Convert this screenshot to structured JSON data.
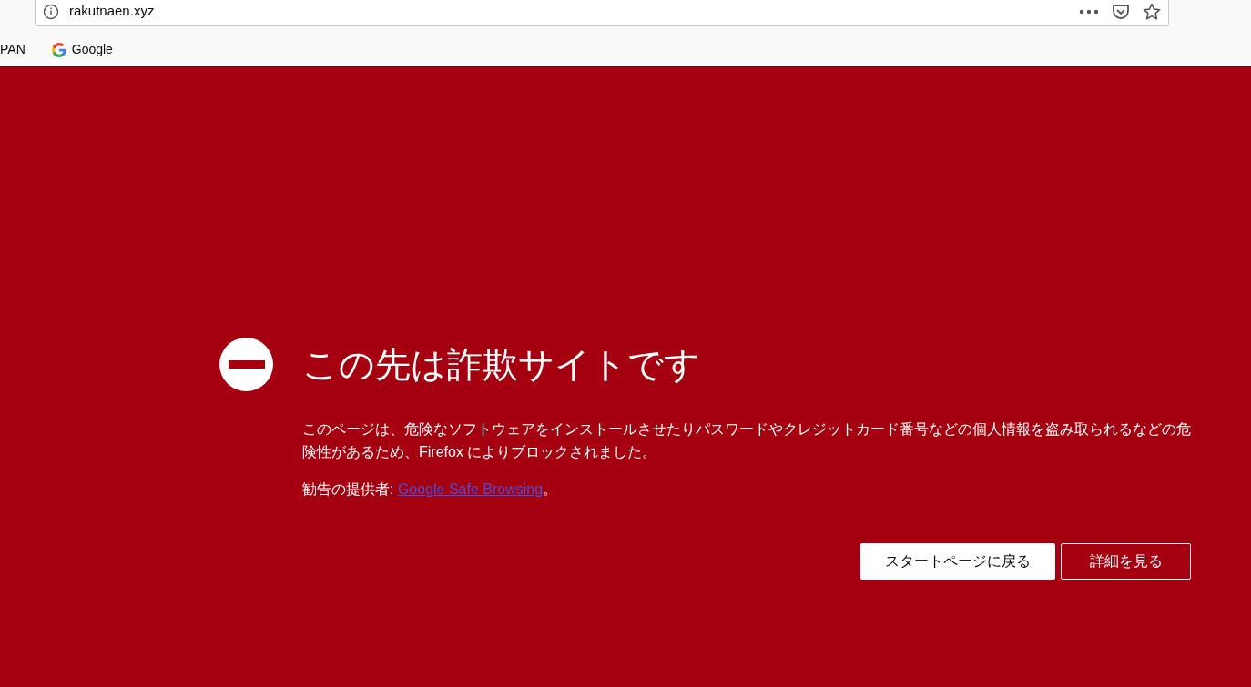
{
  "address_bar": {
    "url": "rakutnaen.xyz"
  },
  "bookmarks": [
    {
      "label": "PAN",
      "kind": "text"
    },
    {
      "label": "Google",
      "kind": "google"
    }
  ],
  "warning": {
    "title": "この先は詐欺サイトです",
    "description": "このページは、危険なソフトウェアをインストールさせたりパスワードやクレジットカード番号などの個人情報を盗み取られるなどの危険性があるため、Firefox によりブロックされました。",
    "advisory_label": "勧告の提供者: ",
    "advisory_link": "Google Safe Browsing",
    "advisory_end": "。",
    "buttons": [
      {
        "label": "スタートページに戻る",
        "kind": "primary"
      },
      {
        "label": "詳細を見る",
        "kind": "secondary"
      }
    ]
  }
}
